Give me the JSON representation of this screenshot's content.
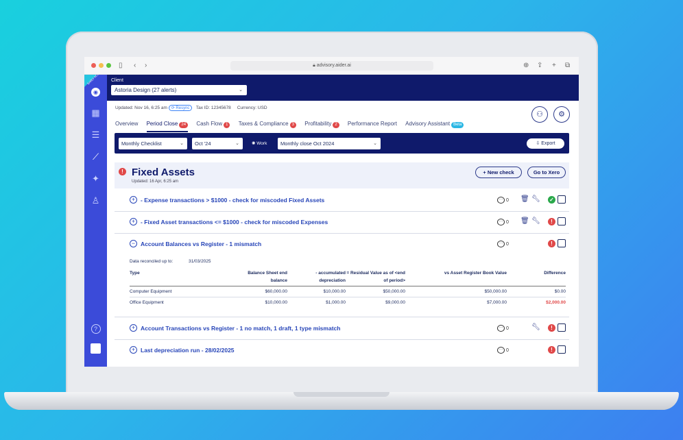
{
  "browser": {
    "url": "advisory.aider.ai"
  },
  "sidebar": {
    "ribbon": "EARLY ACCESS"
  },
  "header": {
    "client_label": "Client",
    "client_value": "Astoria Design (27 alerts)"
  },
  "meta": {
    "updated": "Updated: Nov 16, 6:25 am",
    "resync": "Resync",
    "tax_id": "Tax ID: 12345678",
    "currency": "Currency: USD"
  },
  "tabs": [
    {
      "label": "Overview"
    },
    {
      "label": "Period Close",
      "badge": "24",
      "active": true
    },
    {
      "label": "Cash Flow",
      "badge": "1"
    },
    {
      "label": "Taxes & Compliance",
      "badge": "3"
    },
    {
      "label": "Profitability",
      "badge": "2"
    },
    {
      "label": "Performance Report"
    },
    {
      "label": "Advisory Assistant",
      "badge": "Beta"
    }
  ],
  "filters": {
    "checklist": "Monthly Checklist",
    "period": "Oct '24",
    "work_label": "Work",
    "work": "Monthly close Oct 2024",
    "export": "Export"
  },
  "section": {
    "title": "Fixed Assets",
    "updated": "Updated: 16 Apr, 6:25 am",
    "new_check": "New check",
    "go_to_xero": "Go to Xero"
  },
  "checks": [
    {
      "label": "- Expense transactions > $1000 - check for miscoded Fixed Assets",
      "comments": "0",
      "status": "ok"
    },
    {
      "label": "- Fixed Asset transactions <= $1000 - check for miscoded Expenses",
      "comments": "0",
      "status": "error"
    },
    {
      "label": "Account Balances vs Register - 1 mismatch",
      "comments": "0",
      "status": "error"
    },
    {
      "label": "Account Transactions vs Register - 1 no match, 1 draft, 1 type mismatch",
      "comments": "0",
      "status": "error"
    },
    {
      "label": "Last depreciation run - 28/02/2025",
      "comments": "0",
      "status": "error"
    }
  ],
  "recon": {
    "label": "Data reconciled up to:",
    "date": "31/03/2025"
  },
  "table": {
    "headers": [
      "Type",
      "Balance Sheet end balance",
      "- accumulated depreciation",
      "= Residual Value as of <end of period>",
      "vs Asset Register Book Value",
      "Difference"
    ],
    "rows": [
      [
        "Computer Equipment",
        "$60,000.00",
        "$10,000.00",
        "$50,000.00",
        "$50,000.00",
        "$0.00"
      ],
      [
        "Office Equipment",
        "$10,000.00",
        "$1,000.00",
        "$9,000.00",
        "$7,000.00",
        "$2,000.00"
      ]
    ]
  },
  "colors": {
    "navy": "#0f1a6b",
    "sidebar": "#3b4bd9",
    "alert": "#e04848",
    "ok": "#2aa84a"
  }
}
